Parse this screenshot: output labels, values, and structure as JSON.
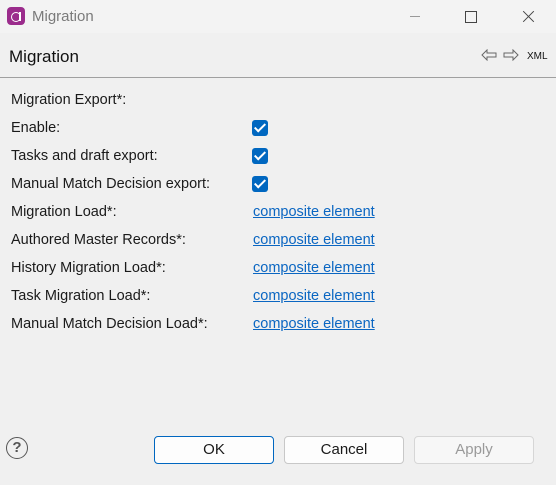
{
  "window": {
    "title": "Migration"
  },
  "header": {
    "title": "Migration",
    "xml_label": "XML"
  },
  "form": {
    "section_label": "Migration Export*:",
    "checkbox_rows": [
      {
        "label": "Enable:",
        "checked": true
      },
      {
        "label": "Tasks and draft export:",
        "checked": true
      },
      {
        "label": "Manual Match Decision export:",
        "checked": true
      }
    ],
    "link_rows": [
      {
        "label": "Migration Load*:",
        "link": "composite element"
      },
      {
        "label": "Authored Master Records*:",
        "link": "composite element"
      },
      {
        "label": "History Migration Load*:",
        "link": "composite element"
      },
      {
        "label": "Task Migration Load*:",
        "link": "composite element"
      },
      {
        "label": "Manual Match Decision Load*:",
        "link": "composite element"
      }
    ]
  },
  "footer": {
    "help_glyph": "?",
    "ok_label": "OK",
    "cancel_label": "Cancel",
    "apply_label": "Apply"
  },
  "icons": {
    "app": "app-icon",
    "back": "arrow-left-icon",
    "forward": "arrow-right-icon",
    "help": "help-icon"
  },
  "colors": {
    "accent": "#0067c0",
    "link": "#0a66c2",
    "app_icon": "#9b2c8c"
  }
}
